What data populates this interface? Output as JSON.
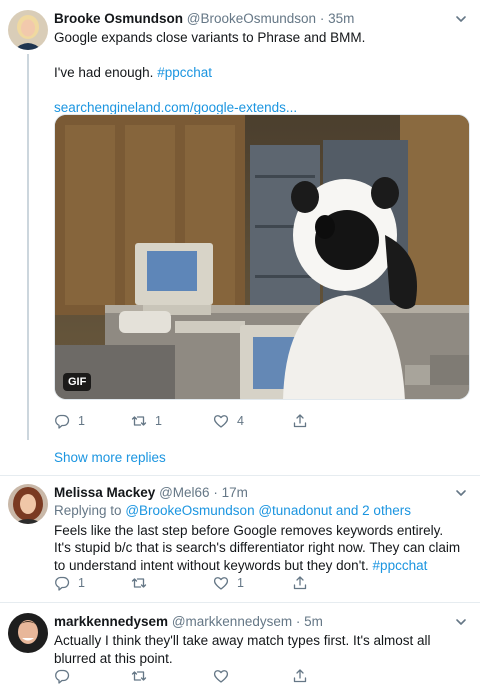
{
  "tweets": [
    {
      "name": "Brooke Osmundson",
      "handle": "@BrookeOsmundson",
      "time": "35m",
      "line1": "Google expands close variants to Phrase and BMM.",
      "line2_text": "I've had enough.",
      "hashtag": "#ppcchat",
      "link": "searchengineland.com/google-extends...",
      "gif_badge": "GIF",
      "replies": "1",
      "retweets": "1",
      "likes": "4"
    },
    {
      "name": "Melissa Mackey",
      "handle": "@Mel66",
      "time": "17m",
      "replying_label": "Replying to",
      "replying_to_1": "@BrookeOsmundson",
      "replying_to_2": "@tunadonut",
      "replying_and": "and",
      "replying_others": "2 others",
      "text": "Feels like the last step before Google removes keywords entirely. It's stupid b/c that is search's differentiator right now. They can claim to understand intent without keywords but they don't.",
      "hashtag": "#ppcchat",
      "replies": "1",
      "retweets": "",
      "likes": "1"
    },
    {
      "name": "markkennedysem",
      "handle": "@markkennedysem",
      "time": "5m",
      "text": "Actually I think they'll take away match types first. It's almost all blurred at this point.",
      "replies": "",
      "retweets": "",
      "likes": ""
    }
  ],
  "show_more_replies": "Show more replies",
  "separator": "·",
  "colors": {
    "link": "#1b95e0",
    "muted": "#657786",
    "text": "#14171a",
    "border": "#e6ecf0"
  }
}
